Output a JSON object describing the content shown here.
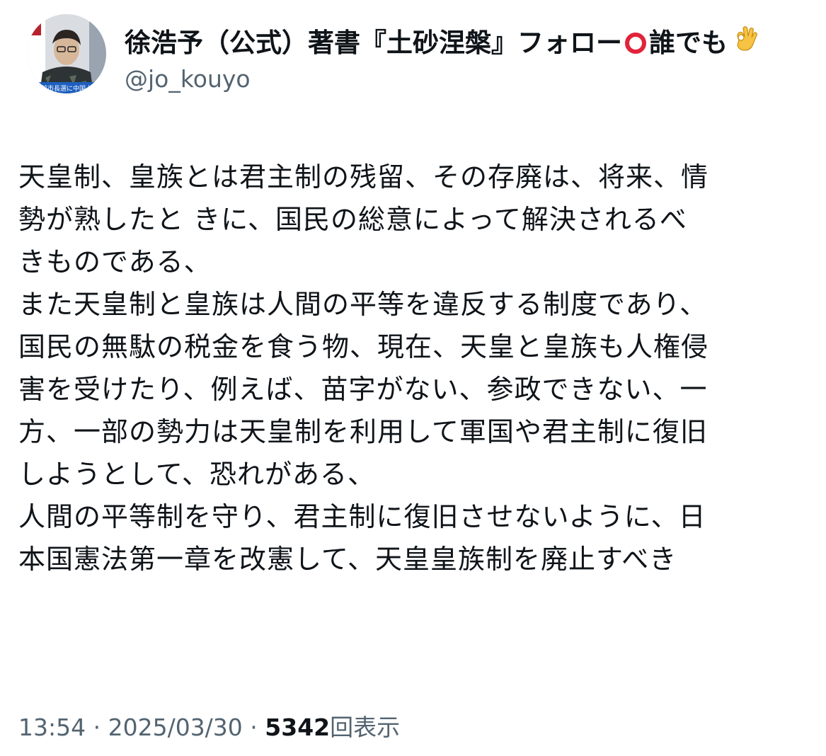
{
  "author": {
    "display_name_part1": "徐浩予（公式）著書『土砂涅槃』フォロー",
    "display_name_part2": "誰でも",
    "handle": "@jo_kouyo",
    "avatar_caption": "前市長選に中国人"
  },
  "post": {
    "lines": [
      "天皇制、皇族とは君主制の残留、その存廃は、将来、情",
      "勢が熟したと きに、国民の総意によって解決されるべ",
      "きものである、",
      "また天皇制と皇族は人間の平等を違反する制度であり、",
      "国民の無駄の税金を食う物、現在、天皇と皇族も人権侵",
      "害を受けたり、例えば、苗字がない、参政できない、一",
      "方、一部の勢力は天皇制を利用して軍国や君主制に復旧",
      "しようとして、恐れがある、",
      "人間の平等制を守り、君主制に復旧させないように、日",
      "本国憲法第一章を改憲して、天皇皇族制を廃止すべき"
    ]
  },
  "meta": {
    "time": "13:54",
    "separator": " · ",
    "date": "2025/03/30",
    "views_count": "5342",
    "views_label": "回表示"
  },
  "icons": {
    "circle": "red-circle-emoji-icon",
    "ok_hand": "ok-hand-emoji-icon"
  },
  "colors": {
    "text": "#0f1419",
    "secondary": "#536471",
    "circle": "#e0243a"
  }
}
